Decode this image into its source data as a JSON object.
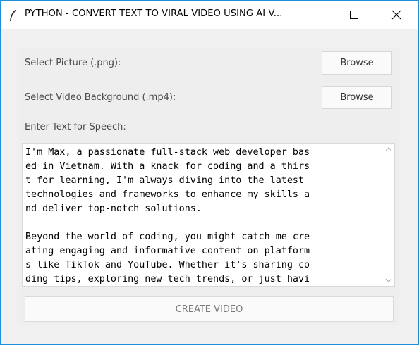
{
  "window": {
    "title": "PYTHON - CONVERT TEXT TO VIRAL VIDEO USING AI V...",
    "icon": "feather-icon",
    "controls": [
      "minimize-icon",
      "maximize-icon",
      "close-icon"
    ]
  },
  "form": {
    "picture_label": "Select Picture (.png):",
    "picture_browse": "Browse",
    "video_label": "Select Video Background (.mp4):",
    "video_browse": "Browse",
    "text_label": "Enter Text for Speech:",
    "text_value": "I'm Max, a passionate full-stack web developer bas\ned in Vietnam. With a knack for coding and a thirs\nt for learning, I'm always diving into the latest\ntechnologies and frameworks to enhance my skills a\nnd deliver top-notch solutions.\n\nBeyond the world of coding, you might catch me cre\nating engaging and informative content on platform\ns like TikTok and YouTube. Whether it's sharing co\nding tips, exploring new tech trends, or just havi",
    "create_button": "CREATE VIDEO"
  },
  "colors": {
    "window_border": "#1e8fd6",
    "background": "#f0f0f0",
    "panel": "#eeeeee"
  }
}
